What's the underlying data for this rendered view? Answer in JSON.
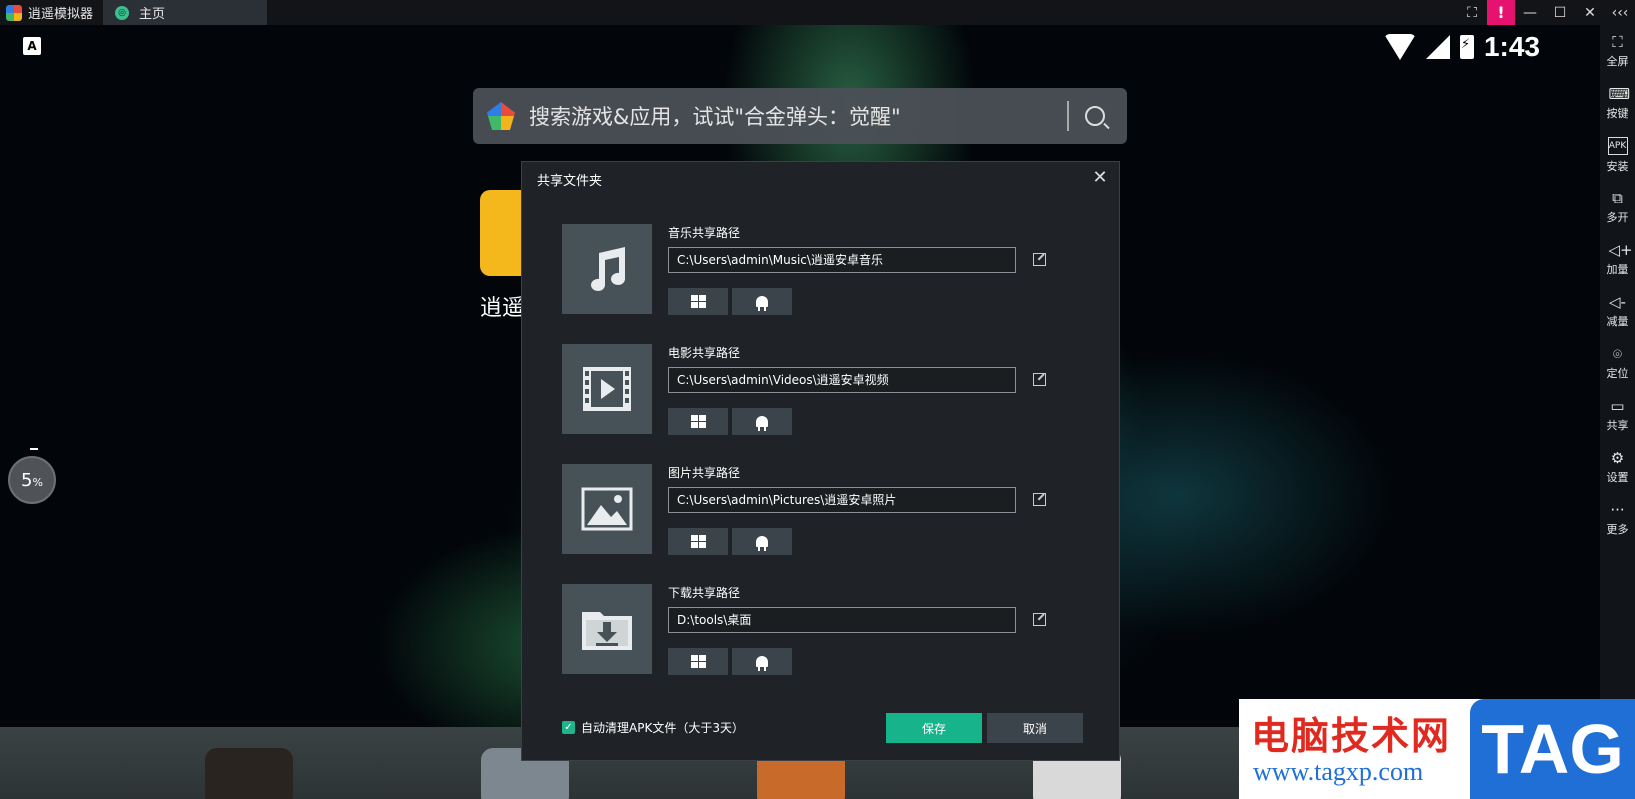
{
  "titlebar": {
    "app_name": "逍遥模拟器",
    "home_tab": "主页",
    "alert": "!"
  },
  "status": {
    "keyboard_indicator": "A",
    "time": "1:43"
  },
  "search": {
    "placeholder": "搜索游戏&应用，试试\"合金弹头：觉醒\""
  },
  "background": {
    "app_label": "逍遥",
    "progress_value": "5",
    "progress_unit": "%"
  },
  "sidebar": {
    "items": [
      {
        "label": "全屏",
        "icon": "fullscreen-icon"
      },
      {
        "label": "按键",
        "icon": "keyboard-icon"
      },
      {
        "label": "安装",
        "icon": "apk-icon"
      },
      {
        "label": "多开",
        "icon": "multi-instance-icon"
      },
      {
        "label": "加量",
        "icon": "volume-up-icon"
      },
      {
        "label": "减量",
        "icon": "volume-down-icon"
      },
      {
        "label": "定位",
        "icon": "location-icon"
      },
      {
        "label": "共享",
        "icon": "folder-icon"
      },
      {
        "label": "设置",
        "icon": "gear-icon"
      },
      {
        "label": "更多",
        "icon": "more-icon"
      }
    ]
  },
  "dialog": {
    "title": "共享文件夹",
    "sections": [
      {
        "label": "音乐共享路径",
        "path": "C:\\Users\\admin\\Music\\逍遥安卓音乐",
        "icon": "music-icon"
      },
      {
        "label": "电影共享路径",
        "path": "C:\\Users\\admin\\Videos\\逍遥安卓视频",
        "icon": "video-icon"
      },
      {
        "label": "图片共享路径",
        "path": "C:\\Users\\admin\\Pictures\\逍遥安卓照片",
        "icon": "image-icon"
      },
      {
        "label": "下载共享路径",
        "path": "D:\\tools\\桌面",
        "icon": "download-folder-icon"
      }
    ],
    "auto_clean_label": "自动清理APK文件（大于3天）",
    "auto_clean_checked": true,
    "save_label": "保存",
    "cancel_label": "取消",
    "accent_color": "#17b38a"
  },
  "watermark": {
    "title": "电脑技术网",
    "url": "www.tagxp.com",
    "tag": "TAG"
  }
}
